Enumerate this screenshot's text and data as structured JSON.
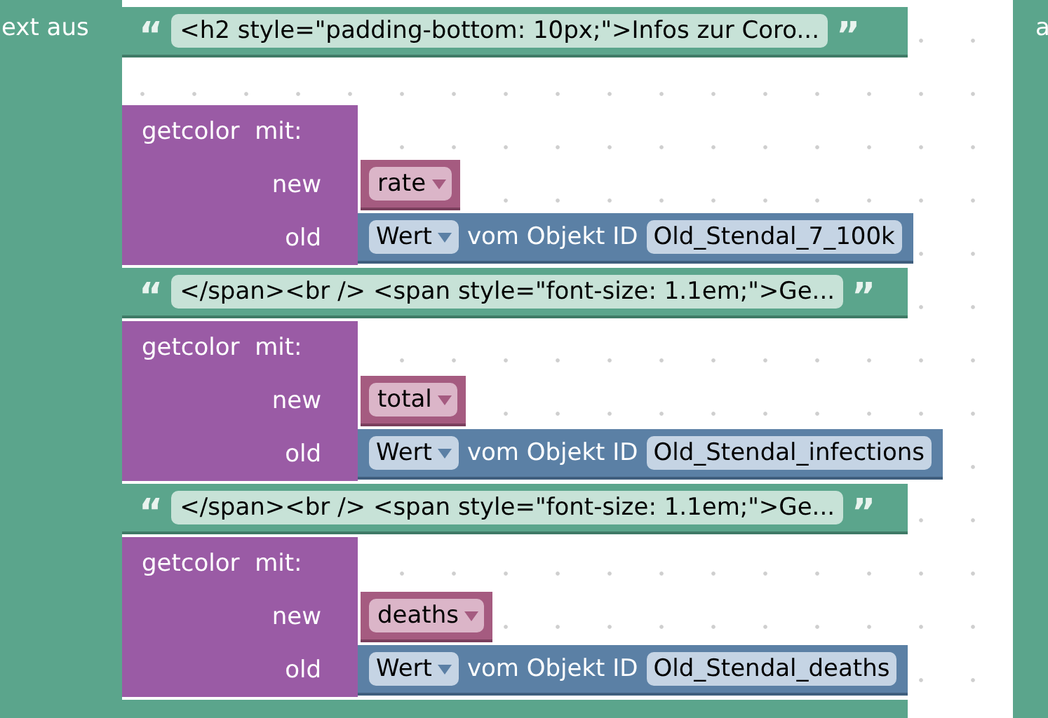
{
  "outer_block": {
    "label": "ext aus"
  },
  "right_block": {
    "label": "a"
  },
  "first_text": {
    "open": "“",
    "value": "<h2 style=\"padding-bottom: 10px;\">Infos zur Coro...",
    "close": "”"
  },
  "stack": [
    {
      "kind": "getcolor",
      "title": "getcolor  mit:",
      "args": [
        {
          "name": "new",
          "kind": "variable",
          "variable": "rate"
        },
        {
          "name": "old",
          "kind": "state",
          "property": "Wert",
          "suffix": "vom Objekt ID",
          "object_id": "Old_Stendal_7_100k"
        }
      ]
    },
    {
      "kind": "text",
      "open": "“",
      "value": "</span><br /> <span style=\"font-size: 1.1em;\">Ge...",
      "close": "”"
    },
    {
      "kind": "getcolor",
      "title": "getcolor  mit:",
      "args": [
        {
          "name": "new",
          "kind": "variable",
          "variable": "total"
        },
        {
          "name": "old",
          "kind": "state",
          "property": "Wert",
          "suffix": "vom Objekt ID",
          "object_id": "Old_Stendal_infections"
        }
      ]
    },
    {
      "kind": "text",
      "open": "“",
      "value": "</span><br /> <span style=\"font-size: 1.1em;\">Ge...",
      "close": "”"
    },
    {
      "kind": "getcolor",
      "title": "getcolor  mit:",
      "args": [
        {
          "name": "new",
          "kind": "variable",
          "variable": "deaths"
        },
        {
          "name": "old",
          "kind": "state",
          "property": "Wert",
          "suffix": "vom Objekt ID",
          "object_id": "Old_Stendal_deaths"
        }
      ]
    },
    {
      "kind": "text"
    }
  ]
}
